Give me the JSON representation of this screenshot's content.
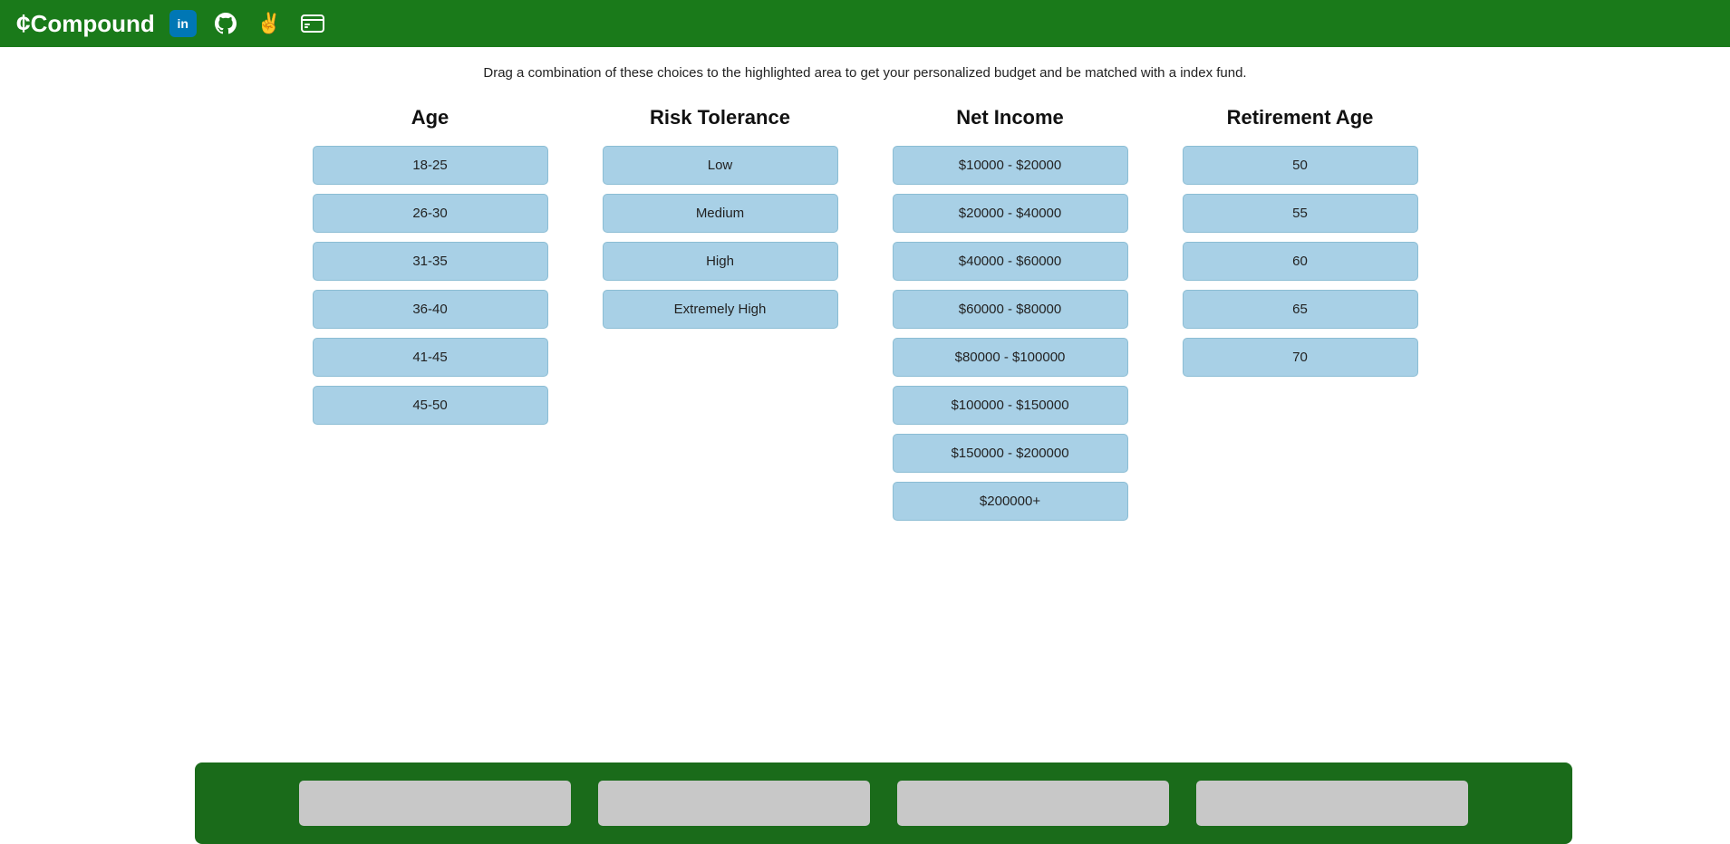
{
  "app": {
    "title": "Compound",
    "logo_symbol": "¢"
  },
  "header": {
    "icons": [
      {
        "name": "linkedin-icon",
        "symbol": "in",
        "label": "LinkedIn"
      },
      {
        "name": "github-icon",
        "symbol": "🐙",
        "label": "GitHub"
      },
      {
        "name": "peace-icon",
        "symbol": "✌",
        "label": "Peace"
      },
      {
        "name": "card-icon",
        "symbol": "🪪",
        "label": "Card"
      }
    ]
  },
  "instruction": "Drag a combination of these choices to the highlighted area to get your personalized budget and be matched with a index fund.",
  "columns": [
    {
      "id": "age",
      "header": "Age",
      "options": [
        "18-25",
        "26-30",
        "31-35",
        "36-40",
        "41-45",
        "45-50"
      ]
    },
    {
      "id": "risk-tolerance",
      "header": "Risk Tolerance",
      "options": [
        "Low",
        "Medium",
        "High",
        "Extremely High"
      ]
    },
    {
      "id": "net-income",
      "header": "Net Income",
      "options": [
        "$10000 - $20000",
        "$20000 - $40000",
        "$40000 - $60000",
        "$60000 - $80000",
        "$80000 - $100000",
        "$100000 - $150000",
        "$150000 - $200000",
        "$200000+"
      ]
    },
    {
      "id": "retirement-age",
      "header": "Retirement Age",
      "options": [
        "50",
        "55",
        "60",
        "65",
        "70"
      ]
    }
  ],
  "drop_zone": {
    "slots": 4
  }
}
